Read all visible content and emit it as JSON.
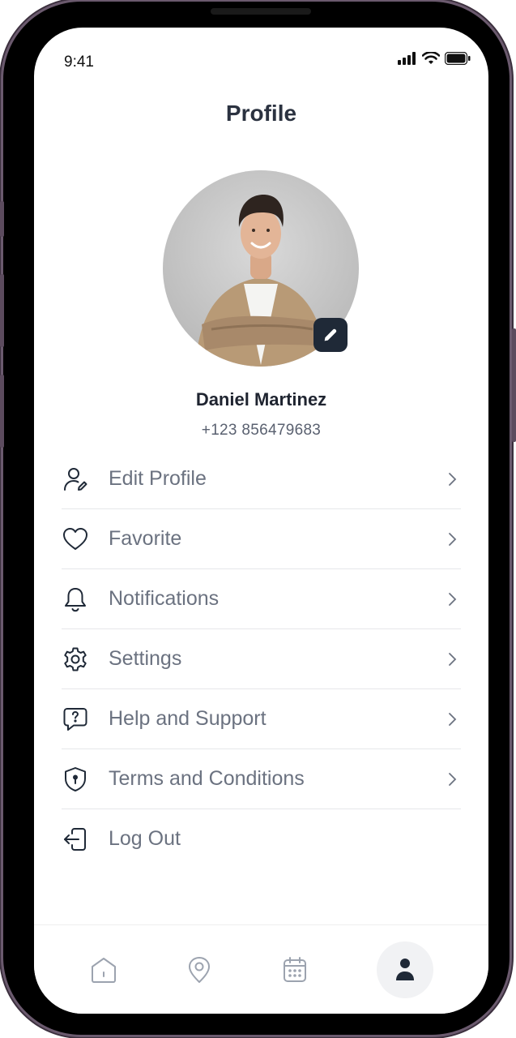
{
  "status_bar": {
    "time": "9:41"
  },
  "header": {
    "title": "Profile"
  },
  "profile": {
    "name": "Daniel Martinez",
    "phone": "+123 856479683"
  },
  "menu": {
    "items": [
      {
        "label": "Edit Profile",
        "icon": "user-edit-icon"
      },
      {
        "label": "Favorite",
        "icon": "heart-icon"
      },
      {
        "label": "Notifications",
        "icon": "bell-icon"
      },
      {
        "label": "Settings",
        "icon": "gear-icon"
      },
      {
        "label": "Help and Support",
        "icon": "help-chat-icon"
      },
      {
        "label": "Terms and Conditions",
        "icon": "shield-icon"
      },
      {
        "label": "Log Out",
        "icon": "logout-icon"
      }
    ]
  },
  "tab_bar": {
    "tabs": [
      {
        "icon": "home-icon",
        "active": false
      },
      {
        "icon": "location-pin-icon",
        "active": false
      },
      {
        "icon": "calendar-icon",
        "active": false
      },
      {
        "icon": "profile-icon",
        "active": true
      }
    ]
  },
  "colors": {
    "text_dark": "#2b3240",
    "text_muted": "#6b7280",
    "accent_dark": "#1f2937"
  }
}
